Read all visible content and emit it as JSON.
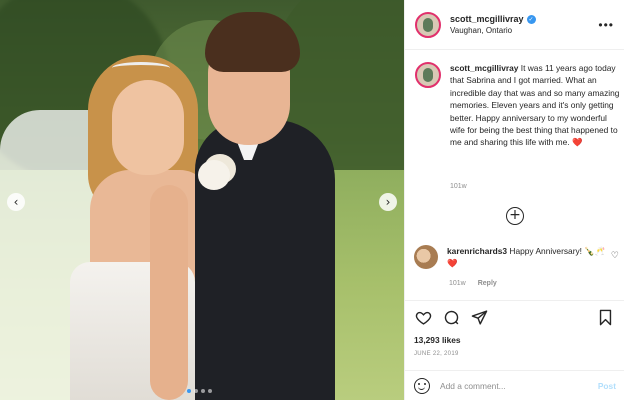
{
  "post": {
    "username": "scott_mcgillivray",
    "location": "Vaughan, Ontario",
    "caption": "It was 11 years ago today that Sabrina and I got married. What an incredible day that was and so many amazing memories. Eleven years and it's only getting better. Happy anniversary to my wonderful wife for being the best thing that happened to me and sharing this life with me.",
    "caption_emoji": "❤️",
    "caption_time": "101w",
    "more_icon": "more-options-icon",
    "verified_icon": "verified-badge-icon"
  },
  "comment": {
    "username": "karenrichards3",
    "text": "Happy Anniversary!",
    "emojis": "🍾🥂❤️",
    "time": "101w",
    "reply_label": "Reply",
    "like_icon": "heart-outline-icon"
  },
  "load_more_icon": "plus-circle-icon",
  "actions": {
    "like_icon": "heart-icon",
    "comment_icon": "comment-icon",
    "share_icon": "share-icon",
    "save_icon": "bookmark-icon"
  },
  "likes": "13,293 likes",
  "date": "JUNE 22, 2019",
  "add_comment": {
    "placeholder": "Add a comment...",
    "post_label": "Post",
    "emoji_icon": "emoji-icon"
  },
  "carousel": {
    "prev_icon": "chevron-left-icon",
    "next_icon": "chevron-right-icon",
    "slide_count": 4,
    "active_index": 0
  },
  "colors": {
    "link_blue": "#3897f0",
    "post_disabled": "#b2dffc",
    "heart_red": "#ed4956",
    "muted": "#8e8e8e"
  }
}
